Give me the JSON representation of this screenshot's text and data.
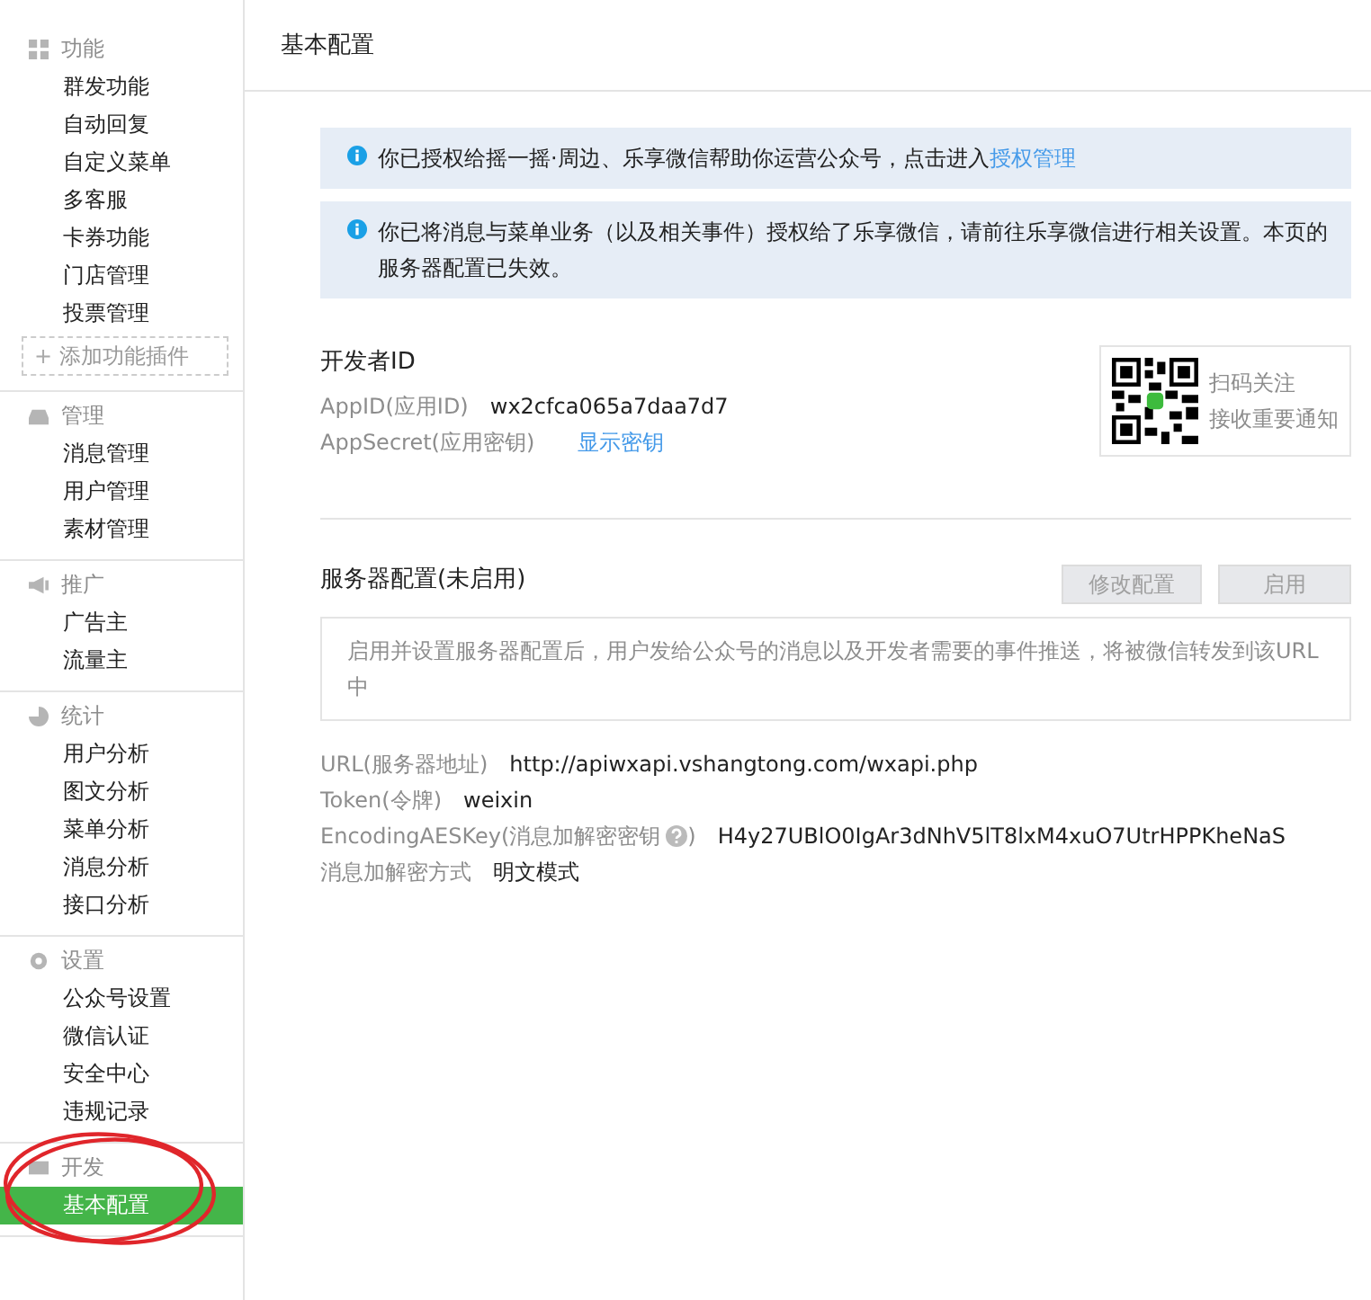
{
  "sidebar": {
    "sections": [
      {
        "title": "功能",
        "items": [
          {
            "label": "群发功能",
            "selected": false
          },
          {
            "label": "自动回复",
            "selected": false
          },
          {
            "label": "自定义菜单",
            "selected": false
          },
          {
            "label": "多客服",
            "selected": false
          },
          {
            "label": "卡券功能",
            "selected": false
          },
          {
            "label": "门店管理",
            "selected": false
          },
          {
            "label": "投票管理",
            "selected": false
          }
        ],
        "add_button": {
          "icon": "+",
          "label": "添加功能插件"
        }
      },
      {
        "title": "管理",
        "items": [
          {
            "label": "消息管理",
            "selected": false
          },
          {
            "label": "用户管理",
            "selected": false
          },
          {
            "label": "素材管理",
            "selected": false
          }
        ]
      },
      {
        "title": "推广",
        "items": [
          {
            "label": "广告主",
            "selected": false
          },
          {
            "label": "流量主",
            "selected": false
          }
        ]
      },
      {
        "title": "统计",
        "items": [
          {
            "label": "用户分析",
            "selected": false
          },
          {
            "label": "图文分析",
            "selected": false
          },
          {
            "label": "菜单分析",
            "selected": false
          },
          {
            "label": "消息分析",
            "selected": false
          },
          {
            "label": "接口分析",
            "selected": false
          }
        ]
      },
      {
        "title": "设置",
        "items": [
          {
            "label": "公众号设置",
            "selected": false
          },
          {
            "label": "微信认证",
            "selected": false
          },
          {
            "label": "安全中心",
            "selected": false
          },
          {
            "label": "违规记录",
            "selected": false
          }
        ]
      },
      {
        "title": "开发",
        "items": [
          {
            "label": "基本配置",
            "selected": true
          }
        ]
      }
    ]
  },
  "main": {
    "title": "基本配置",
    "notices": [
      {
        "text": "你已授权给摇一摇·周边、乐享微信帮助你运营公众号，点击进入",
        "link": "授权管理"
      },
      {
        "text": "你已将消息与菜单业务（以及相关事件）授权给了乐享微信，请前往乐享微信进行相关设置。本页的服务器配置已失效。"
      }
    ],
    "developer": {
      "heading": "开发者ID",
      "rows": [
        {
          "label": "AppID(应用ID)",
          "value": "wx2cfca065a7daa7d7",
          "kind": "text"
        },
        {
          "label": "AppSecret(应用密钥)",
          "value": "显示密钥",
          "kind": "link"
        }
      ]
    },
    "qr": {
      "lines": [
        "扫码关注",
        "接收重要通知"
      ]
    },
    "server": {
      "heading": "服务器配置(未启用)",
      "buttons": [
        {
          "label": "修改配置",
          "disabled": true
        },
        {
          "label": "启用",
          "disabled": true
        }
      ],
      "description": "启用并设置服务器配置后，用户发给公众号的消息以及开发者需要的事件推送，将被微信转发到该URL中",
      "rows": [
        {
          "label": "URL(服务器地址)",
          "value": "http://apiwxapi.vshangtong.com/wxapi.php",
          "help": false
        },
        {
          "label": "Token(令牌)",
          "value": "weixin",
          "help": false
        },
        {
          "label": "EncodingAESKey(消息加解密密钥",
          "help": true,
          "label_end": ")",
          "value": "H4y27UBlO0IgAr3dNhV5lT8lxM4xuO7UtrHPPKheNaS"
        },
        {
          "label": "消息加解密方式",
          "value": "明文模式",
          "help": false
        }
      ]
    }
  }
}
